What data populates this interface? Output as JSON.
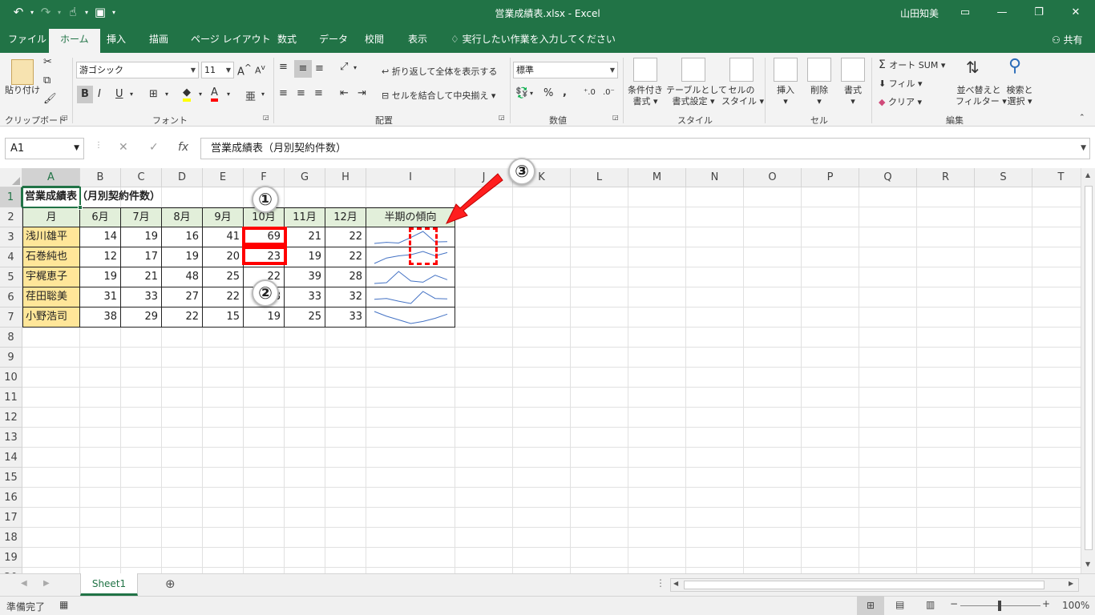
{
  "window": {
    "title": "営業成績表.xlsx  -  Excel",
    "user": "山田知美"
  },
  "ribbon_tabs": [
    "ファイル",
    "ホーム",
    "挿入",
    "描画",
    "ページ レイアウト",
    "数式",
    "データ",
    "校閲",
    "表示"
  ],
  "tell_me": "実行したい作業を入力してください",
  "share": "共有",
  "ribbon": {
    "clipboard": {
      "paste": "貼り付け",
      "group": "クリップボード"
    },
    "font": {
      "name": "游ゴシック",
      "size": "11",
      "group": "フォント"
    },
    "alignment": {
      "wrap": "折り返して全体を表示する",
      "merge": "セルを結合して中央揃え",
      "group": "配置"
    },
    "number": {
      "format": "標準",
      "group": "数値"
    },
    "styles": {
      "conditional_1": "条件付き",
      "conditional_2": "書式",
      "table_1": "テーブルとして",
      "table_2": "書式設定",
      "cell_1": "セルの",
      "cell_2": "スタイル",
      "group": "スタイル"
    },
    "cells": {
      "insert": "挿入",
      "delete": "削除",
      "format": "書式",
      "group": "セル"
    },
    "editing": {
      "autosum": "オート SUM",
      "fill": "フィル",
      "clear": "クリア",
      "sort_1": "並べ替えと",
      "sort_2": "フィルター",
      "find_1": "検索と",
      "find_2": "選択",
      "group": "編集"
    }
  },
  "formula_bar": {
    "name_box": "A1",
    "content": "営業成績表（月別契約件数）"
  },
  "columns": [
    "A",
    "B",
    "C",
    "D",
    "E",
    "F",
    "G",
    "H",
    "I",
    "J",
    "K",
    "L",
    "M",
    "N",
    "O",
    "P",
    "Q",
    "R",
    "S",
    "T"
  ],
  "rows": [
    "1",
    "2",
    "3",
    "4",
    "5",
    "6",
    "7",
    "8",
    "9",
    "10",
    "11",
    "12",
    "13",
    "14",
    "15",
    "16",
    "17",
    "18",
    "19",
    "20"
  ],
  "sheet": {
    "title": "営業成績表（月別契約件数）",
    "header": [
      "月",
      "6月",
      "7月",
      "8月",
      "9月",
      "10月",
      "11月",
      "12月",
      "半期の傾向"
    ],
    "data": [
      {
        "name": "浅川雄平",
        "values": [
          14,
          19,
          16,
          41,
          69,
          21,
          22
        ]
      },
      {
        "name": "石巻純也",
        "values": [
          12,
          17,
          19,
          20,
          23,
          19,
          22
        ]
      },
      {
        "name": "宇梶恵子",
        "values": [
          19,
          21,
          48,
          25,
          22,
          39,
          28
        ]
      },
      {
        "name": "荏田聡美",
        "values": [
          31,
          33,
          27,
          22,
          48,
          33,
          32
        ]
      },
      {
        "name": "小野浩司",
        "values": [
          38,
          29,
          22,
          15,
          19,
          25,
          33
        ]
      }
    ]
  },
  "sheet_tab": "Sheet1",
  "status": {
    "ready": "準備完了",
    "zoom": "100%"
  },
  "annotations": {
    "badge1": "①",
    "badge2": "②",
    "badge3": "③"
  },
  "colors": {
    "accent": "#217346",
    "header_fill": "#e2efda",
    "name_fill": "#ffe699",
    "sparkline": "#4472c4",
    "annotation": "#ff0000"
  }
}
